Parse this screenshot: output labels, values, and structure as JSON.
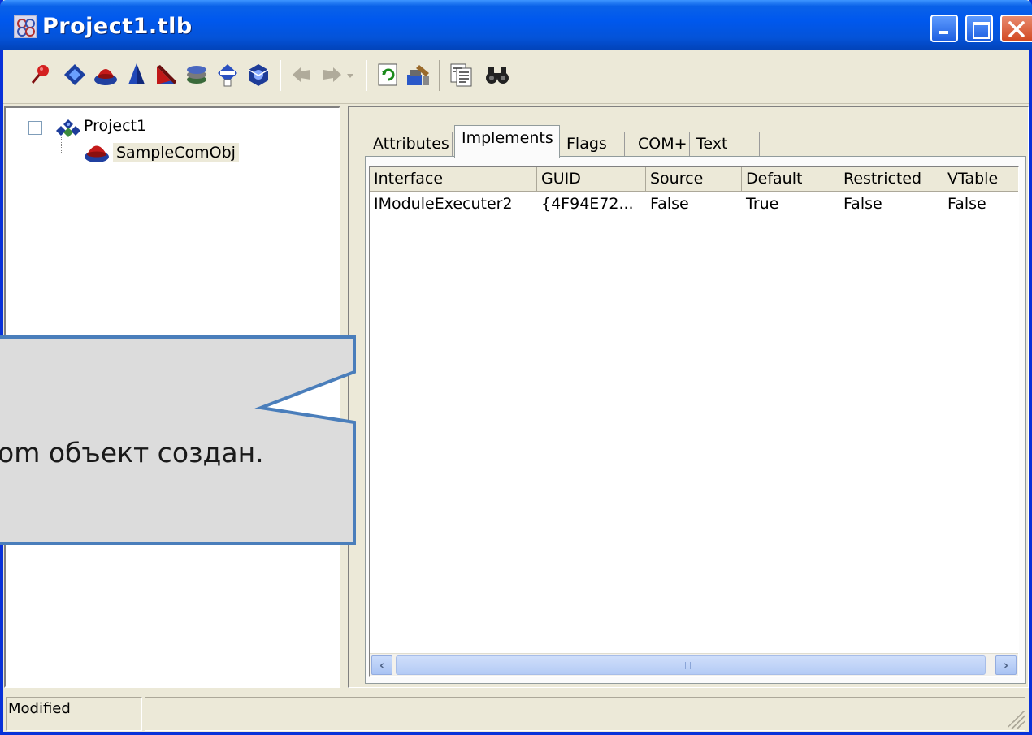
{
  "window": {
    "title": "Project1.tlb"
  },
  "toolbar": {
    "icons": [
      "pin-icon",
      "interface-diamond-icon",
      "coclass-icon",
      "pyramid-icon",
      "module-icon",
      "layers-icon",
      "dispinterface-icon",
      "typelib-icon",
      "back-icon",
      "forward-icon",
      "dropdown-icon",
      "refresh-icon",
      "build-icon",
      "view-text-icon",
      "find-icon"
    ]
  },
  "tree": {
    "root_label": "Project1",
    "child_label": "SampleComObj"
  },
  "tabs": [
    {
      "label": "Attributes"
    },
    {
      "label": "Implements"
    },
    {
      "label": "Flags"
    },
    {
      "label": "COM+"
    },
    {
      "label": "Text"
    }
  ],
  "active_tab": "Implements",
  "list": {
    "columns": [
      "Interface",
      "GUID",
      "Source",
      "Default",
      "Restricted",
      "VTable"
    ],
    "rows": [
      [
        "IModuleExecuter2",
        "{4F94E72...",
        "False",
        "True",
        "False",
        "False"
      ]
    ]
  },
  "status": {
    "text": "Modified"
  },
  "callout": {
    "text": "Com объект создан.",
    "fill": "#dcdcdc",
    "border": "#4a7ebb"
  },
  "colors": {
    "titlebar": "#0058ee",
    "window_face": "#ece9d8"
  }
}
